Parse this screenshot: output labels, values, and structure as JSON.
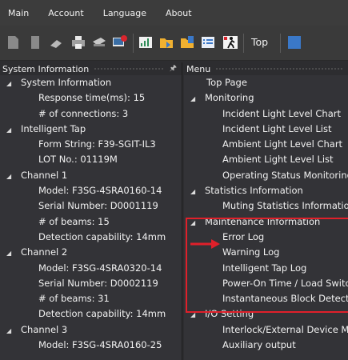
{
  "menubar": {
    "items": [
      "Main",
      "Account",
      "Language",
      "About"
    ]
  },
  "toolbar": {
    "top_label": "Top"
  },
  "left_panel": {
    "title": "System Information",
    "rows": [
      {
        "text": "System Information",
        "level": "lv1t",
        "expand": true
      },
      {
        "text": "Response time(ms): 15",
        "level": "lv2"
      },
      {
        "text": "# of connections: 3",
        "level": "lv2"
      },
      {
        "text": "Intelligent Tap",
        "level": "lv1t",
        "expand": true
      },
      {
        "text": "Form String: F39-SGIT-IL3",
        "level": "lv2"
      },
      {
        "text": "LOT No.: 01119M",
        "level": "lv2"
      },
      {
        "text": "Channel 1",
        "level": "lv1t",
        "expand": true
      },
      {
        "text": "Model: F3SG-4SRA0160-14",
        "level": "lv2"
      },
      {
        "text": "Serial Number: D0001119",
        "level": "lv2"
      },
      {
        "text": "# of beams: 15",
        "level": "lv2"
      },
      {
        "text": "Detection capability: 14mm",
        "level": "lv2"
      },
      {
        "text": "Channel 2",
        "level": "lv1t",
        "expand": true
      },
      {
        "text": "Model: F3SG-4SRA0320-14",
        "level": "lv2"
      },
      {
        "text": "Serial Number: D0002119",
        "level": "lv2"
      },
      {
        "text": "# of beams: 31",
        "level": "lv2"
      },
      {
        "text": "Detection capability: 14mm",
        "level": "lv2"
      },
      {
        "text": "Channel 3",
        "level": "lv1t",
        "expand": true
      },
      {
        "text": "Model: F3SG-4SRA0160-25",
        "level": "lv2"
      }
    ]
  },
  "right_panel": {
    "title": "Menu",
    "rows": [
      {
        "text": "Top Page",
        "level": "lv1"
      },
      {
        "text": "Monitoring",
        "level": "lv1t",
        "expand": true
      },
      {
        "text": "Incident Light Level Chart",
        "level": "lv2"
      },
      {
        "text": "Incident Light Level List",
        "level": "lv2"
      },
      {
        "text": "Ambient Light Level Chart",
        "level": "lv2"
      },
      {
        "text": "Ambient Light Level List",
        "level": "lv2"
      },
      {
        "text": "Operating Status Monitoring",
        "level": "lv2"
      },
      {
        "text": "Statistics Information",
        "level": "lv1t",
        "expand": true
      },
      {
        "text": "Muting Statistics Information",
        "level": "lv2"
      },
      {
        "text": "Maintenance Information",
        "level": "lv1t",
        "expand": true
      },
      {
        "text": "Error Log",
        "level": "lv2"
      },
      {
        "text": "Warning Log",
        "level": "lv2"
      },
      {
        "text": "Intelligent Tap Log",
        "level": "lv2"
      },
      {
        "text": "Power-On Time / Load Switching",
        "level": "lv2"
      },
      {
        "text": "Instantaneous Block Detection",
        "level": "lv2"
      },
      {
        "text": "I/O Setting",
        "level": "lv1t",
        "expand": true
      },
      {
        "text": "Interlock/External Device Monitoring",
        "level": "lv2"
      },
      {
        "text": "Auxiliary output",
        "level": "lv2"
      }
    ]
  },
  "colors": {
    "highlight": "#e0202a",
    "background": "#333337"
  }
}
